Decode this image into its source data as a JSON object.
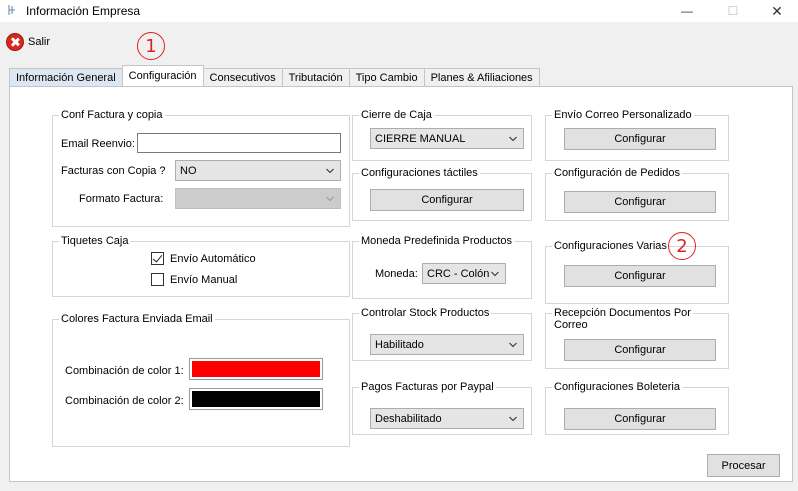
{
  "window": {
    "title": "Información Empresa",
    "minimize": "—",
    "maximize": "☐",
    "close": "✕"
  },
  "toolbar": {
    "salir_label": "Salir"
  },
  "annotations": {
    "one": "1",
    "two": "2"
  },
  "tabs": [
    {
      "label": "Información General"
    },
    {
      "label": "Configuración"
    },
    {
      "label": "Consecutivos"
    },
    {
      "label": "Tributación"
    },
    {
      "label": "Tipo Cambio"
    },
    {
      "label": "Planes & Afiliaciones"
    }
  ],
  "conf_factura": {
    "title": "Conf Factura y copia",
    "email_label": "Email Reenvio:",
    "email_value": "",
    "copia_label": "Facturas con Copia ?",
    "copia_value": "NO",
    "formato_label": "Formato Factura:",
    "formato_value": ""
  },
  "tiquetes": {
    "title": "Tiquetes Caja",
    "auto_label": "Envío Automático",
    "auto_checked": true,
    "manual_label": "Envío Manual",
    "manual_checked": false
  },
  "colores": {
    "title": "Colores Factura Enviada Email",
    "color1_label": "Combinación de color 1:",
    "color1": "#ff0000",
    "color2_label": "Combinación de color 2:",
    "color2": "#000000"
  },
  "cierre_caja": {
    "title": "Cierre de Caja",
    "value": "CIERRE MANUAL"
  },
  "tactiles": {
    "title": "Configuraciones táctiles",
    "button": "Configurar"
  },
  "moneda": {
    "title": "Moneda Predefinida Productos",
    "label": "Moneda:",
    "value": "CRC - Colón"
  },
  "stock": {
    "title": "Controlar Stock Productos",
    "value": "Habilitado"
  },
  "paypal": {
    "title": "Pagos Facturas por Paypal",
    "value": "Deshabilitado"
  },
  "correo": {
    "title": "Envío Correo Personalizado",
    "button": "Configurar"
  },
  "pedidos": {
    "title": "Configuración de Pedidos",
    "button": "Configurar"
  },
  "varias": {
    "title": "Configuraciones Varias",
    "button": "Configurar"
  },
  "recepcion": {
    "title_line1": "Recepción Documentos Por",
    "title_line2": "Correo",
    "button": "Configurar"
  },
  "boleteria": {
    "title": "Configuraciones Boleteria",
    "button": "Configurar"
  },
  "procesar_label": "Procesar"
}
